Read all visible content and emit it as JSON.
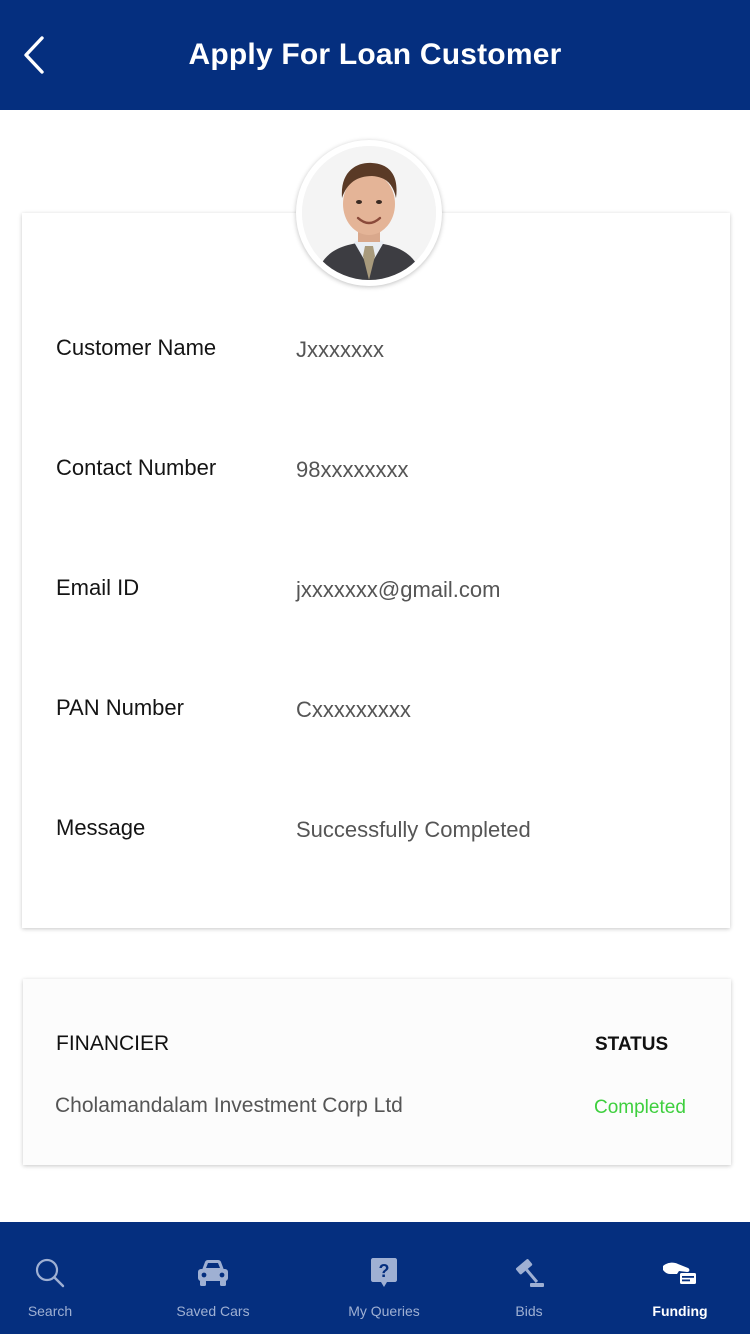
{
  "header": {
    "title": "Apply For Loan Customer"
  },
  "details": [
    {
      "label": "Customer Name",
      "value": "Jxxxxxxx"
    },
    {
      "label": "Contact Number",
      "value": "98xxxxxxxx"
    },
    {
      "label": "Email ID",
      "value": "jxxxxxxx@gmail.com"
    },
    {
      "label": "PAN Number",
      "value": "Cxxxxxxxxx"
    },
    {
      "label": "Message",
      "value": "Successfully Completed"
    }
  ],
  "financier": {
    "column_financier": "FINANCIER",
    "column_status": "STATUS",
    "name": "Cholamandalam Investment Corp Ltd",
    "status": "Completed"
  },
  "tabs": [
    {
      "label": "Search",
      "icon": "search-icon"
    },
    {
      "label": "Saved Cars",
      "icon": "car-icon"
    },
    {
      "label": "My Queries",
      "icon": "question-icon"
    },
    {
      "label": "Bids",
      "icon": "gavel-icon"
    },
    {
      "label": "Funding",
      "icon": "funding-icon",
      "active": true
    }
  ],
  "colors": {
    "brand_blue": "#052f7f",
    "status_green": "#3ecf3e",
    "tab_inactive": "#9fb0d3"
  }
}
